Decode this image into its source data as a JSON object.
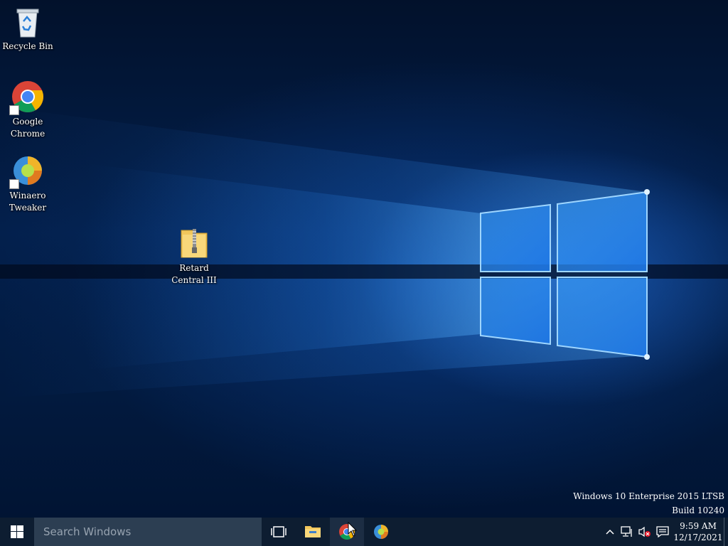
{
  "desktop": {
    "icons": [
      {
        "label": "Recycle Bin",
        "icon": "recycle-bin-icon"
      },
      {
        "label": "Google\nChrome",
        "icon": "chrome-icon"
      },
      {
        "label": "Winaero\nTweaker",
        "icon": "winaero-tweaker-icon"
      },
      {
        "label": "Retard\nCentral III",
        "icon": "zip-folder-icon"
      }
    ],
    "watermark": {
      "line1": "Windows 10 Enterprise 2015 LTSB",
      "line2": "Build 10240"
    }
  },
  "taskbar": {
    "search_placeholder": "Search Windows",
    "pinned": [
      "task-view-icon",
      "file-explorer-icon",
      "chrome-icon",
      "winaero-tweaker-icon"
    ],
    "tray": {
      "icons": [
        "chevron-up-icon",
        "network-icon",
        "volume-muted-icon",
        "action-center-icon"
      ],
      "time": "9:59 AM",
      "date": "12/17/2021"
    }
  },
  "colors": {
    "taskbar": "#0d1d31",
    "search_box": "#2c3e52",
    "windows_blue": "#1e90ff"
  }
}
